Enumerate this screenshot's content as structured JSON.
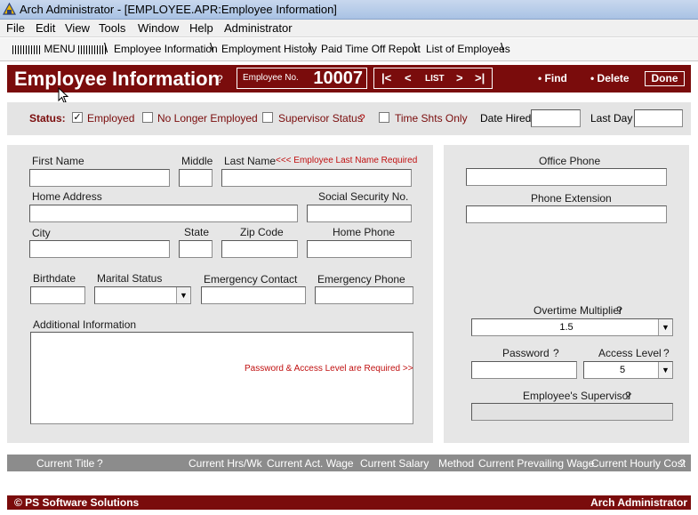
{
  "window": {
    "title": "Arch Administrator - [EMPLOYEE.APR:Employee Information]"
  },
  "menu": [
    "File",
    "Edit",
    "View",
    "Tools",
    "Window",
    "Help",
    "Administrator"
  ],
  "tabs": {
    "menu": "MENU",
    "items": [
      "Employee Information",
      "Employment History",
      "Paid Time Off Report",
      "List of Employees"
    ]
  },
  "header": {
    "title": "Employee Information",
    "help": "?",
    "employee_no_label": "Employee No.",
    "employee_no": "10007",
    "nav": {
      "first": "|<",
      "prev": "<",
      "list": "LIST",
      "next": ">",
      "last": ">|"
    },
    "find": "• Find",
    "delete": "• Delete",
    "done": "Done"
  },
  "status": {
    "label": "Status:",
    "employed": {
      "label": "Employed",
      "checked": true
    },
    "no_longer_employed": {
      "label": "No Longer Employed",
      "checked": false
    },
    "supervisor_status": {
      "label": "Supervisor Status",
      "help": "?",
      "checked": false
    },
    "time_shts_only": {
      "label": "Time Shts Only",
      "checked": false
    },
    "date_hired": {
      "label": "Date Hired",
      "value": ""
    },
    "last_day": {
      "label": "Last Day",
      "value": ""
    }
  },
  "form": {
    "first_name": {
      "label": "First Name",
      "value": ""
    },
    "middle": {
      "label": "Middle",
      "value": ""
    },
    "last_name": {
      "label": "Last Name",
      "value": "",
      "warning": "<<< Employee Last Name Required"
    },
    "home_address": {
      "label": "Home Address",
      "value": ""
    },
    "ssn": {
      "label": "Social Security No.",
      "value": ""
    },
    "city": {
      "label": "City",
      "value": ""
    },
    "state": {
      "label": "State",
      "value": ""
    },
    "zip": {
      "label": "Zip Code",
      "value": ""
    },
    "home_phone": {
      "label": "Home Phone",
      "value": ""
    },
    "birthdate": {
      "label": "Birthdate",
      "value": ""
    },
    "marital_status": {
      "label": "Marital Status",
      "value": ""
    },
    "emergency_contact": {
      "label": "Emergency Contact",
      "value": ""
    },
    "emergency_phone": {
      "label": "Emergency Phone",
      "value": ""
    },
    "additional_info": {
      "label": "Additional Information",
      "value": ""
    },
    "password_note": "Password & Access Level are Required >>"
  },
  "right_panel": {
    "office_phone": {
      "label": "Office Phone",
      "value": ""
    },
    "phone_extension": {
      "label": "Phone Extension",
      "value": ""
    },
    "overtime_multiplier": {
      "label": "Overtime Multiplier",
      "help": "?",
      "value": "1.5"
    },
    "password": {
      "label": "Password",
      "help": "?",
      "value": ""
    },
    "access_level": {
      "label": "Access Level",
      "help": "?",
      "value": "5"
    },
    "supervisor": {
      "label": "Employee's Supervisor",
      "help": "?",
      "value": ""
    }
  },
  "info_bar": {
    "current_title": "Current Title",
    "help": "?",
    "current_hrs_wk": "Current Hrs/Wk",
    "current_act_wage": "Current Act. Wage",
    "current_salary": "Current Salary",
    "method": "Method",
    "current_prevailing_wage": "Current Prevailing Wage",
    "current_hourly_cost": "Current Hourly Cost",
    "hourly_help": "?"
  },
  "footer": {
    "copyright": "© PS Software Solutions",
    "app": "Arch Administrator"
  },
  "colors": {
    "brand": "#7a0c0c",
    "panel": "#e6e6e6",
    "warning": "#c01010"
  }
}
